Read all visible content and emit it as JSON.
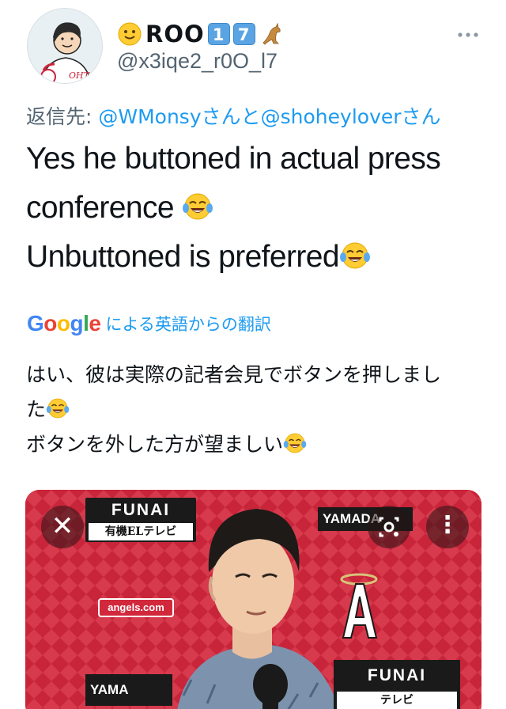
{
  "author": {
    "display_name": "ROO",
    "keycap_1": "1",
    "keycap_2": "7",
    "handle": "@x3iqe2_r0O_l7",
    "avatar_badge_text": "OHTA"
  },
  "reply": {
    "prefix": "返信先: ",
    "mention_1": "@WMonsy",
    "joiner_1": "さんと",
    "mention_2": "@shoheylover",
    "joiner_2": "さん"
  },
  "tweet": {
    "line_1": "Yes he buttoned in actual press",
    "line_2": "conference ",
    "line_3": "Unbuttoned is preferred"
  },
  "translation": {
    "logo": "Google",
    "label": "による英語からの翻訳",
    "line_1": "はい、彼は実際の記者会見でボタンを押しまし",
    "line_2": "た",
    "line_3": "ボタンを外した方が望ましい"
  },
  "media": {
    "backdrop_brand_1": "FUNAI",
    "backdrop_sub_1": "有機ELテレビ",
    "backdrop_brand_2": "YAMADA",
    "backdrop_angels": "angels.com",
    "backdrop_brand_3": "YAMA",
    "backdrop_brand_4": "FUNAI",
    "backdrop_sub_4": "テレビ",
    "close_glyph": "✕",
    "menu_glyph": "⋮"
  },
  "icons": {
    "more": "more-horizontal-icon",
    "laugh": "face-with-tears-of-joy-icon",
    "smile": "slightly-smiling-face-icon",
    "kangaroo": "kangaroo-icon"
  },
  "colors": {
    "accent": "#1d9bf0",
    "secondary_text": "#536471",
    "backdrop_red": "#c8253a"
  }
}
